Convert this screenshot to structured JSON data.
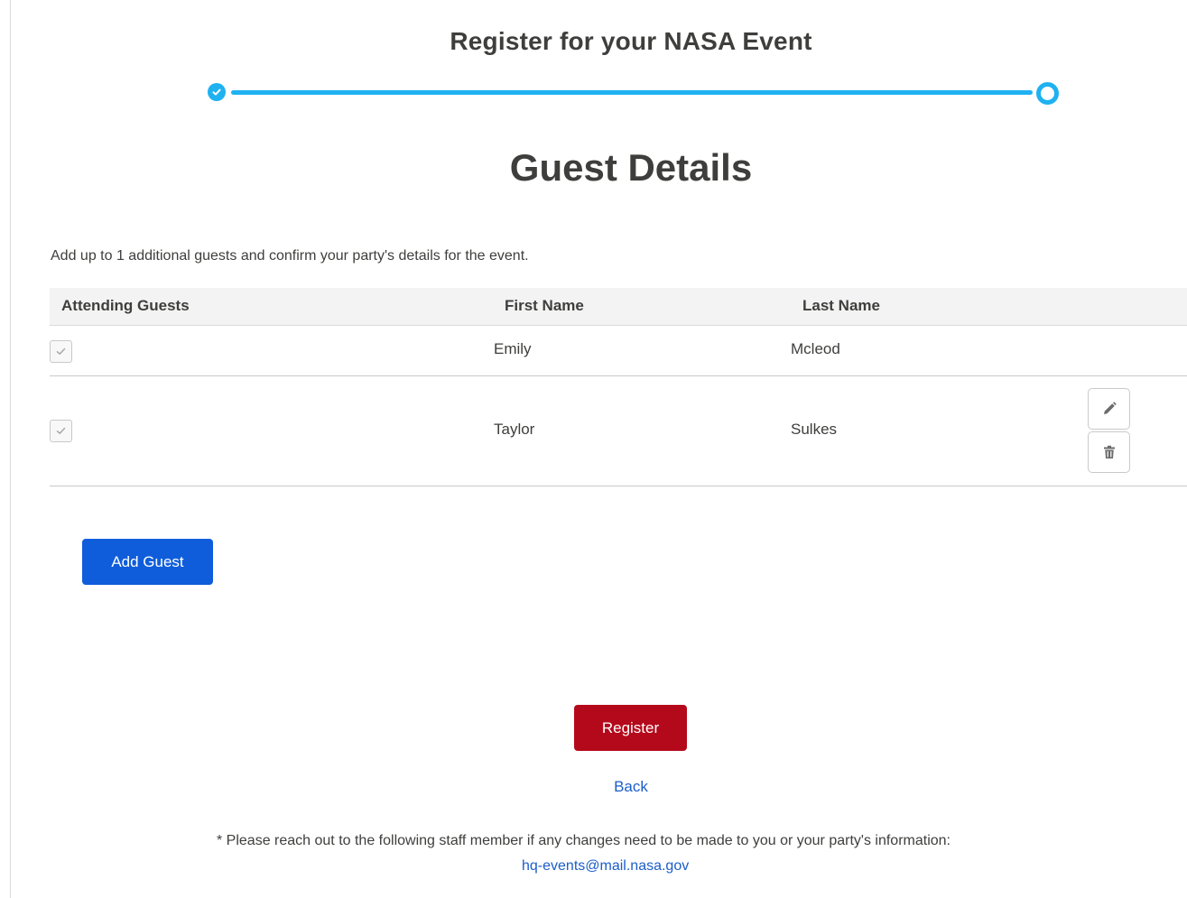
{
  "header": {
    "title": "Register for your NASA Event"
  },
  "progress": {
    "steps_total": 2,
    "current_step": 2
  },
  "section": {
    "title": "Guest Details",
    "intro": "Add up to 1 additional guests and confirm your party's details for the event."
  },
  "table": {
    "columns": [
      "Attending Guests",
      "First Name",
      "Last Name"
    ],
    "rows": [
      {
        "attending": true,
        "first_name": "Emily",
        "last_name": "Mcleod",
        "editable": false
      },
      {
        "attending": true,
        "first_name": "Taylor",
        "last_name": "Sulkes",
        "editable": true
      }
    ]
  },
  "actions": {
    "add_guest_label": "Add Guest",
    "register_label": "Register",
    "back_label": "Back"
  },
  "footer": {
    "note": "* Please reach out to the following staff member if any changes need to be made to you or your party's information:",
    "email": "hq-events@mail.nasa.gov"
  },
  "colors": {
    "progress_accent": "#1fb1f0",
    "primary_button": "#0f5ddb",
    "register_button": "#b4091b",
    "link": "#1b5ec8"
  },
  "icons": {
    "completed_step": "check-circle-icon",
    "current_step": "ring-icon",
    "checkbox_mark": "check-icon",
    "edit": "pencil-icon",
    "delete": "trash-icon"
  }
}
